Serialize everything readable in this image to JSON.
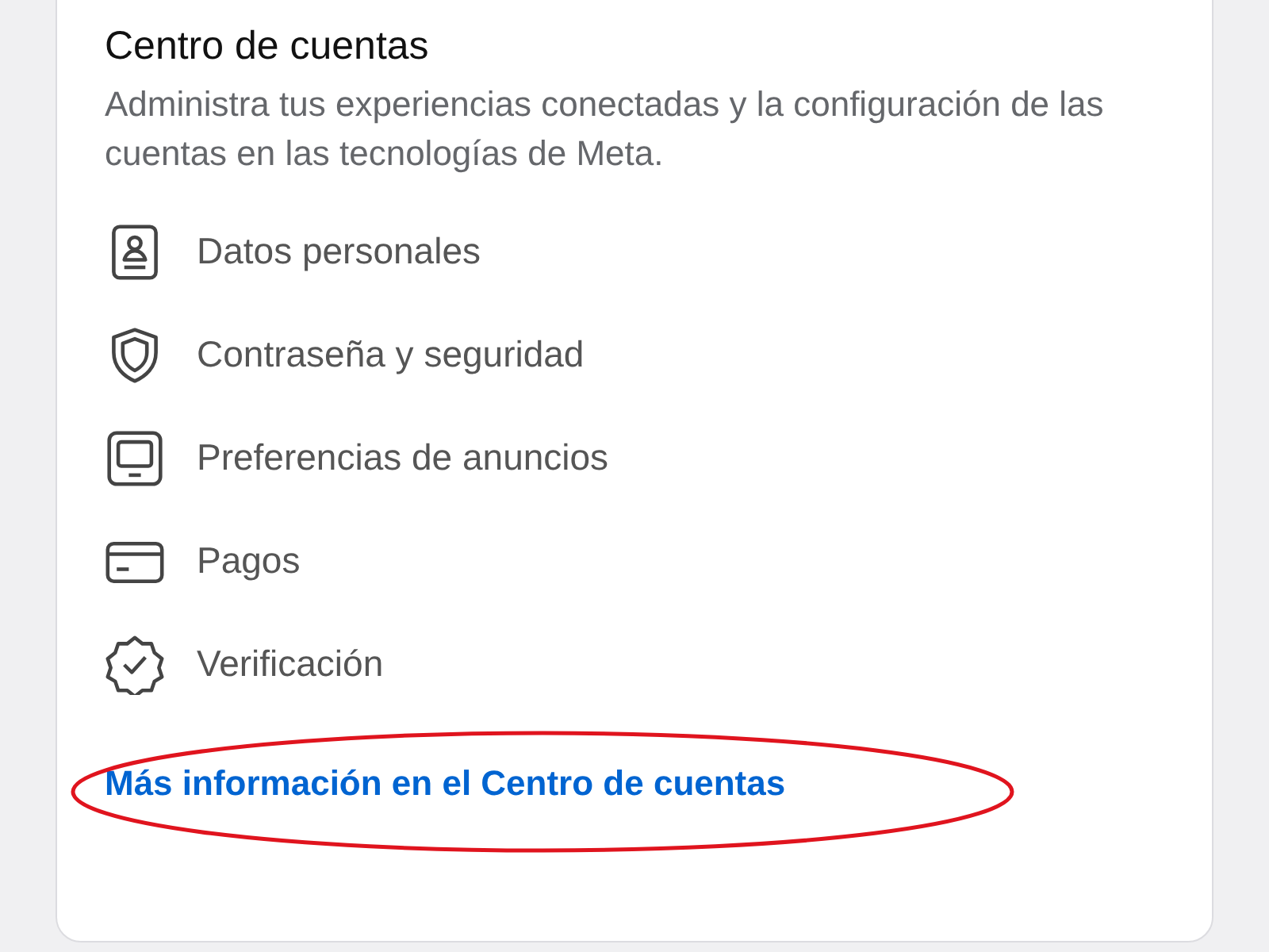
{
  "section": {
    "title": "Centro de cuentas",
    "description": "Administra tus experiencias conectadas y la configuración de las cuentas en las tecnologías de Meta."
  },
  "items": [
    {
      "kind": "id",
      "label": "Datos personales"
    },
    {
      "kind": "shield",
      "label": "Contraseña y seguridad"
    },
    {
      "kind": "monitor",
      "label": "Preferencias de anuncios"
    },
    {
      "kind": "card",
      "label": "Pagos"
    },
    {
      "kind": "badge",
      "label": "Verificación"
    }
  ],
  "link": {
    "label": "Más información en el Centro de cuentas",
    "circled": true
  }
}
